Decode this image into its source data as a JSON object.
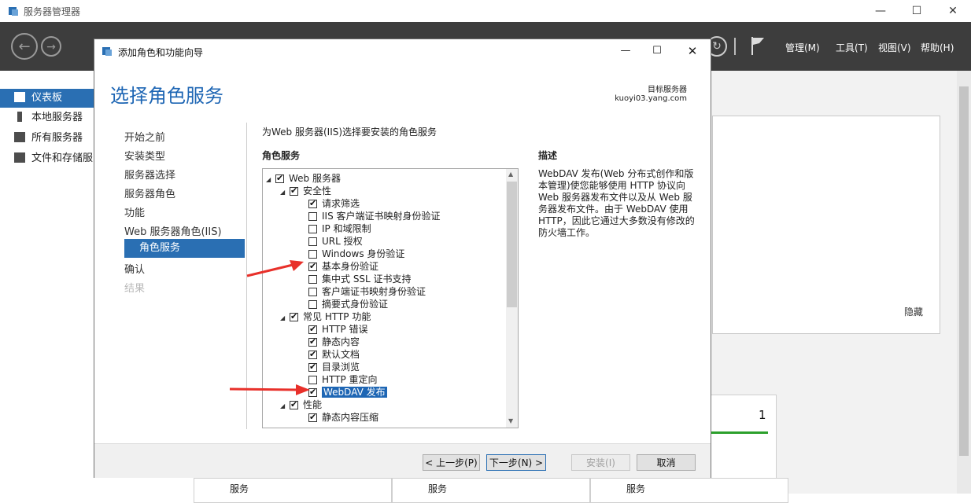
{
  "sm": {
    "title": "服务器管理器",
    "menu": [
      "管理(M)",
      "工具(T)",
      "视图(V)",
      "帮助(H)"
    ],
    "sidebar": [
      "仪表板",
      "本地服务器",
      "所有服务器",
      "文件和存储服"
    ],
    "hide_label": "隐藏",
    "tile_count": "1",
    "tile_label": "服务"
  },
  "dialog": {
    "window_title": "添加角色和功能向导",
    "main_title": "选择角色服务",
    "target_label": "目标服务器",
    "target_name": "kuoyi03.yang.com",
    "steps": [
      "开始之前",
      "安装类型",
      "服务器选择",
      "服务器角色",
      "功能",
      "Web 服务器角色(IIS)",
      "角色服务",
      "确认",
      "结果"
    ],
    "instruction": "为Web 服务器(IIS)选择要安装的角色服务",
    "services_header": "角色服务",
    "desc_header": "描述",
    "description": "WebDAV 发布(Web 分布式创作和版本管理)使您能够使用 HTTP 协议向 Web 服务器发布文件以及从 Web 服务器发布文件。由于 WebDAV 使用 HTTP，因此它通过大多数没有修改的防火墙工作。",
    "tree": [
      {
        "label": "Web 服务器",
        "checked": true,
        "expander": true
      },
      {
        "label": "安全性",
        "checked": true,
        "expander": true
      },
      {
        "label": "请求筛选",
        "checked": true
      },
      {
        "label": "IIS 客户端证书映射身份验证",
        "checked": false
      },
      {
        "label": "IP 和域限制",
        "checked": false
      },
      {
        "label": "URL 授权",
        "checked": false
      },
      {
        "label": "Windows 身份验证",
        "checked": false
      },
      {
        "label": "基本身份验证",
        "checked": true
      },
      {
        "label": "集中式 SSL 证书支持",
        "checked": false
      },
      {
        "label": "客户端证书映射身份验证",
        "checked": false
      },
      {
        "label": "摘要式身份验证",
        "checked": false
      },
      {
        "label": "常见 HTTP 功能",
        "checked": true,
        "expander": true
      },
      {
        "label": "HTTP 错误",
        "checked": true
      },
      {
        "label": "静态内容",
        "checked": true
      },
      {
        "label": "默认文档",
        "checked": true
      },
      {
        "label": "目录浏览",
        "checked": true
      },
      {
        "label": "HTTP 重定向",
        "checked": false
      },
      {
        "label": "WebDAV 发布",
        "checked": true,
        "selected": true
      },
      {
        "label": "性能",
        "checked": true,
        "expander": true
      },
      {
        "label": "静态内容压缩",
        "checked": true
      }
    ],
    "buttons": {
      "prev": "< 上一步(P)",
      "next": "下一步(N) >",
      "install": "安装(I)",
      "cancel": "取消"
    }
  },
  "colors": {
    "accent": "#2a6fb3",
    "title_blue": "#1e66b4",
    "arrow": "#e8302a",
    "toolbar": "#3d3d3d"
  }
}
